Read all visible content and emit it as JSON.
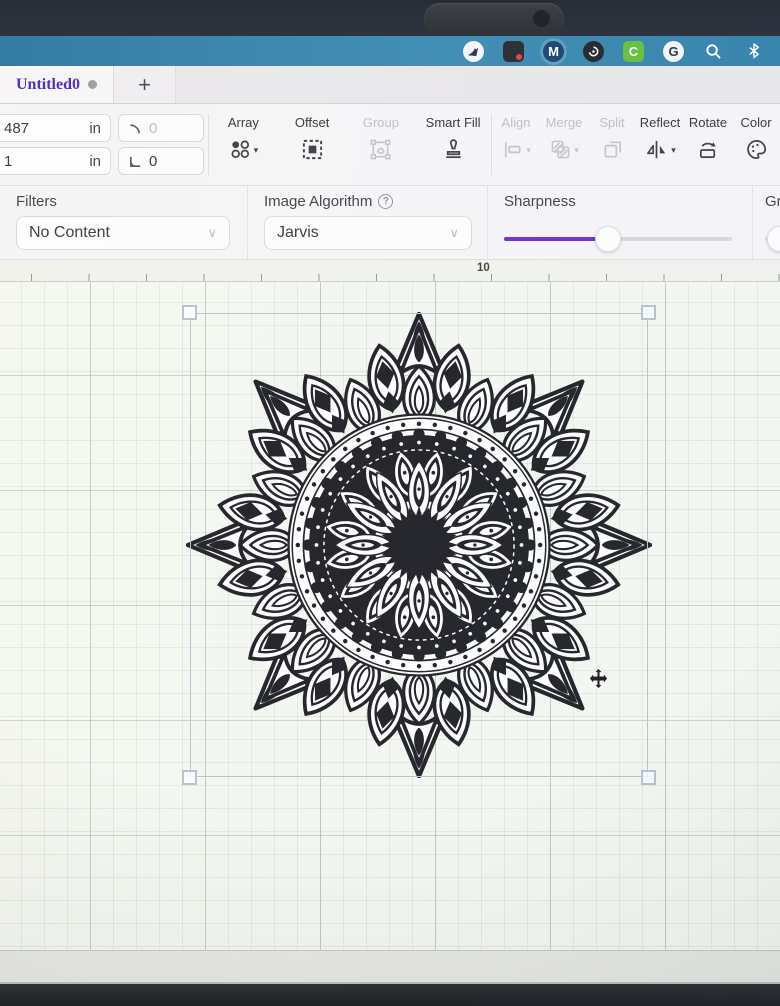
{
  "menubar": {
    "icons": [
      {
        "name": "round-app-icon",
        "style": "light-svg",
        "svg": "fan"
      },
      {
        "name": "pixel-app-icon",
        "style": "darkbadge",
        "glyph": ""
      },
      {
        "name": "m-app-icon",
        "style": "blue",
        "glyph": "M"
      },
      {
        "name": "swirl-app-icon",
        "style": "dark-svg",
        "svg": "swirl"
      },
      {
        "name": "c-app-icon",
        "style": "green",
        "glyph": "C"
      },
      {
        "name": "g-app-icon",
        "style": "light",
        "glyph": "G"
      },
      {
        "name": "spotlight-search-icon",
        "style": "glyph-svg",
        "svg": "search"
      },
      {
        "name": "bluetooth-icon",
        "style": "glyph-svg",
        "svg": "bluetooth"
      }
    ]
  },
  "tabs": {
    "active_label": "Untitled0",
    "new_tab_label": "+"
  },
  "transform_fields": {
    "width": {
      "value": "487",
      "unit": "in"
    },
    "height": {
      "value": "1",
      "unit": "in"
    },
    "rotate": {
      "value": "0",
      "disabled": true
    },
    "skew": {
      "value": "0",
      "disabled": false
    }
  },
  "toolbar": {
    "groups": [
      {
        "items": [
          {
            "label": "Array",
            "icon": "array",
            "enabled": true,
            "caret": true
          },
          {
            "label": "Offset",
            "icon": "offset",
            "enabled": true,
            "caret": false
          },
          {
            "label": "Group",
            "icon": "group",
            "enabled": false,
            "caret": false
          },
          {
            "label": "Smart Fill",
            "icon": "smartfill",
            "enabled": true,
            "caret": false
          }
        ]
      },
      {
        "items": [
          {
            "label": "Align",
            "icon": "align",
            "enabled": false,
            "caret": true
          },
          {
            "label": "Merge",
            "icon": "merge",
            "enabled": false,
            "caret": true
          },
          {
            "label": "Split",
            "icon": "split",
            "enabled": false,
            "caret": false
          },
          {
            "label": "Reflect",
            "icon": "reflect",
            "enabled": true,
            "caret": true
          },
          {
            "label": "Rotate",
            "icon": "rotate",
            "enabled": true,
            "caret": false
          },
          {
            "label": "Color",
            "icon": "color",
            "enabled": true,
            "caret": false
          }
        ]
      }
    ]
  },
  "settings": {
    "filters": {
      "label": "Filters",
      "value": "No Content"
    },
    "image_algorithm": {
      "label": "Image Algorithm",
      "help_glyph": "?",
      "value": "Jarvis"
    },
    "sharpness": {
      "label": "Sharpness",
      "percent": 45
    },
    "grayscale": {
      "label": "Grays",
      "percent": 2,
      "fill_direction": "right"
    }
  },
  "ruler": {
    "visible_label": "10"
  },
  "canvas": {
    "artwork_name": "mandala",
    "selected": true
  },
  "colors": {
    "accent_purple": "#6d28d9",
    "tab_title_purple": "#4326c8",
    "menubar_teal": "#2f7ea8",
    "ink": "#1b1c22"
  }
}
